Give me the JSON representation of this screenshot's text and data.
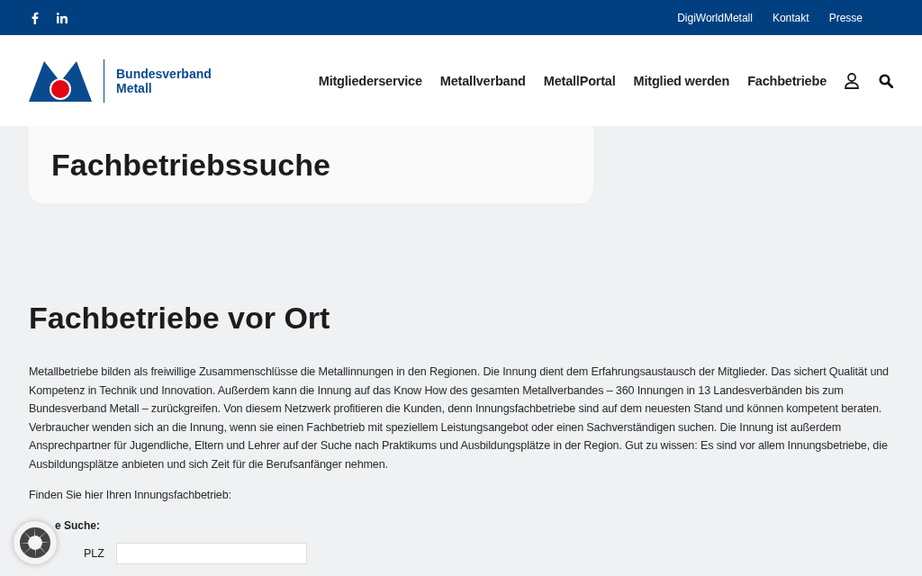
{
  "topbar": {
    "social": [
      {
        "kind": "facebook"
      },
      {
        "kind": "linkedin"
      }
    ],
    "links": [
      "DigiWorldMetall",
      "Kontakt",
      "Presse"
    ]
  },
  "header": {
    "logo": {
      "line_1": "Bundesverband",
      "line_2": "Metall"
    },
    "nav": [
      "Mitgliederservice",
      "Metallverband",
      "MetallPortal",
      "Mitglied werden",
      "Fachbetriebe"
    ]
  },
  "page_title": "Fachbetriebssuche",
  "section": {
    "heading": "Fachbetriebe vor Ort",
    "paragraph": "Metallbetriebe bilden als freiwillige Zusammenschlüsse die Metallinnungen in den Regionen. Die Innung dient dem Erfahrungsaustausch der Mitglieder. Das sichert Qualität und Kompetenz in Technik und Innovation. Außerdem kann die Innung auf das Know How des gesamten Metallverbandes – 360 Innungen in 13 Landesverbänden bis zum Bundesverband Metall – zurückgreifen. Von diesem Netzwerk profitieren die Kunden, denn Innungsfachbetriebe sind auf dem neuesten Stand und können kompetent beraten. Verbraucher wenden sich an die Innung, wenn sie einen Fachbetrieb mit speziellem Leistungsangebot oder einen Sachverständigen suchen. Die Innung ist außerdem Ansprechpartner für Jugendliche, Eltern und Lehrer auf der Suche nach Praktikums und Ausbildungsplätze in der Region. Gut zu wissen: Es sind vor allem Innungsbetriebe, die Ausbildungsplätze anbieten und sich Zeit für die Berufsanfänger nehmen.",
    "intro": "Finden Sie hier Ihren Innungsfachbetrieb:"
  },
  "search": {
    "label": "e Suche:",
    "fields": [
      {
        "label": "PLZ"
      }
    ]
  }
}
